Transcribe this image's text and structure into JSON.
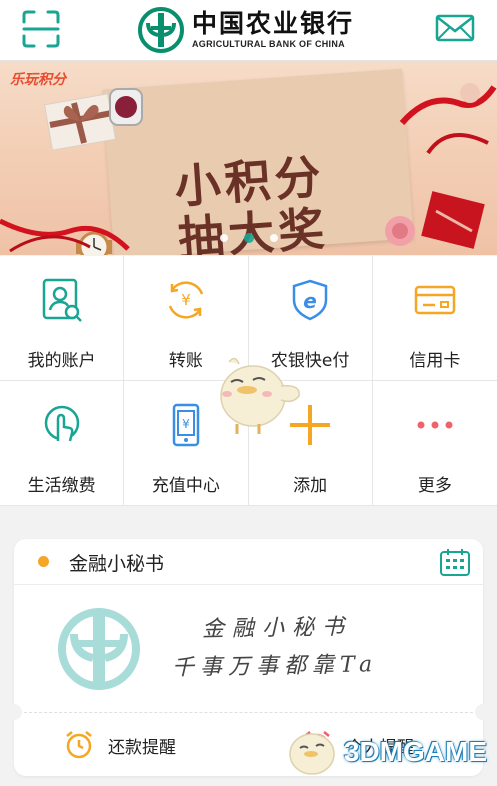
{
  "header": {
    "bank_name_cn": "中国农业银行",
    "bank_name_en": "AGRICULTURAL BANK OF CHINA",
    "left_icon": "scan-icon",
    "right_icon": "mail-icon"
  },
  "banner": {
    "tag": "乐玩积分",
    "title_line1": "小积分",
    "title_line2": "抽大奖",
    "slides": 3,
    "active_slide": 2
  },
  "menu": {
    "items": [
      {
        "label": "我的账户",
        "icon": "account-icon"
      },
      {
        "label": "转账",
        "icon": "transfer-icon"
      },
      {
        "label": "农银快e付",
        "icon": "e-pay-icon"
      },
      {
        "label": "信用卡",
        "icon": "credit-card-icon"
      },
      {
        "label": "生活缴费",
        "icon": "life-payment-icon"
      },
      {
        "label": "充值中心",
        "icon": "recharge-icon"
      },
      {
        "label": "添加",
        "icon": "plus-icon"
      },
      {
        "label": "更多",
        "icon": "more-icon"
      }
    ]
  },
  "secretary": {
    "title": "金融小秘书",
    "handwriting_line1": "金融小秘书",
    "handwriting_line2": "千事万事都靠Ta",
    "reminders": [
      {
        "label": "还款提醒",
        "icon": "alarm-clock-icon"
      },
      {
        "label": "个人提醒",
        "icon": "alarm-clock-icon"
      }
    ]
  },
  "watermark": {
    "text": "3DMGAME"
  },
  "colors": {
    "accent_teal": "#18a593",
    "orange": "#f5a623",
    "blue": "#3a8ee6",
    "red": "#f0626b"
  }
}
